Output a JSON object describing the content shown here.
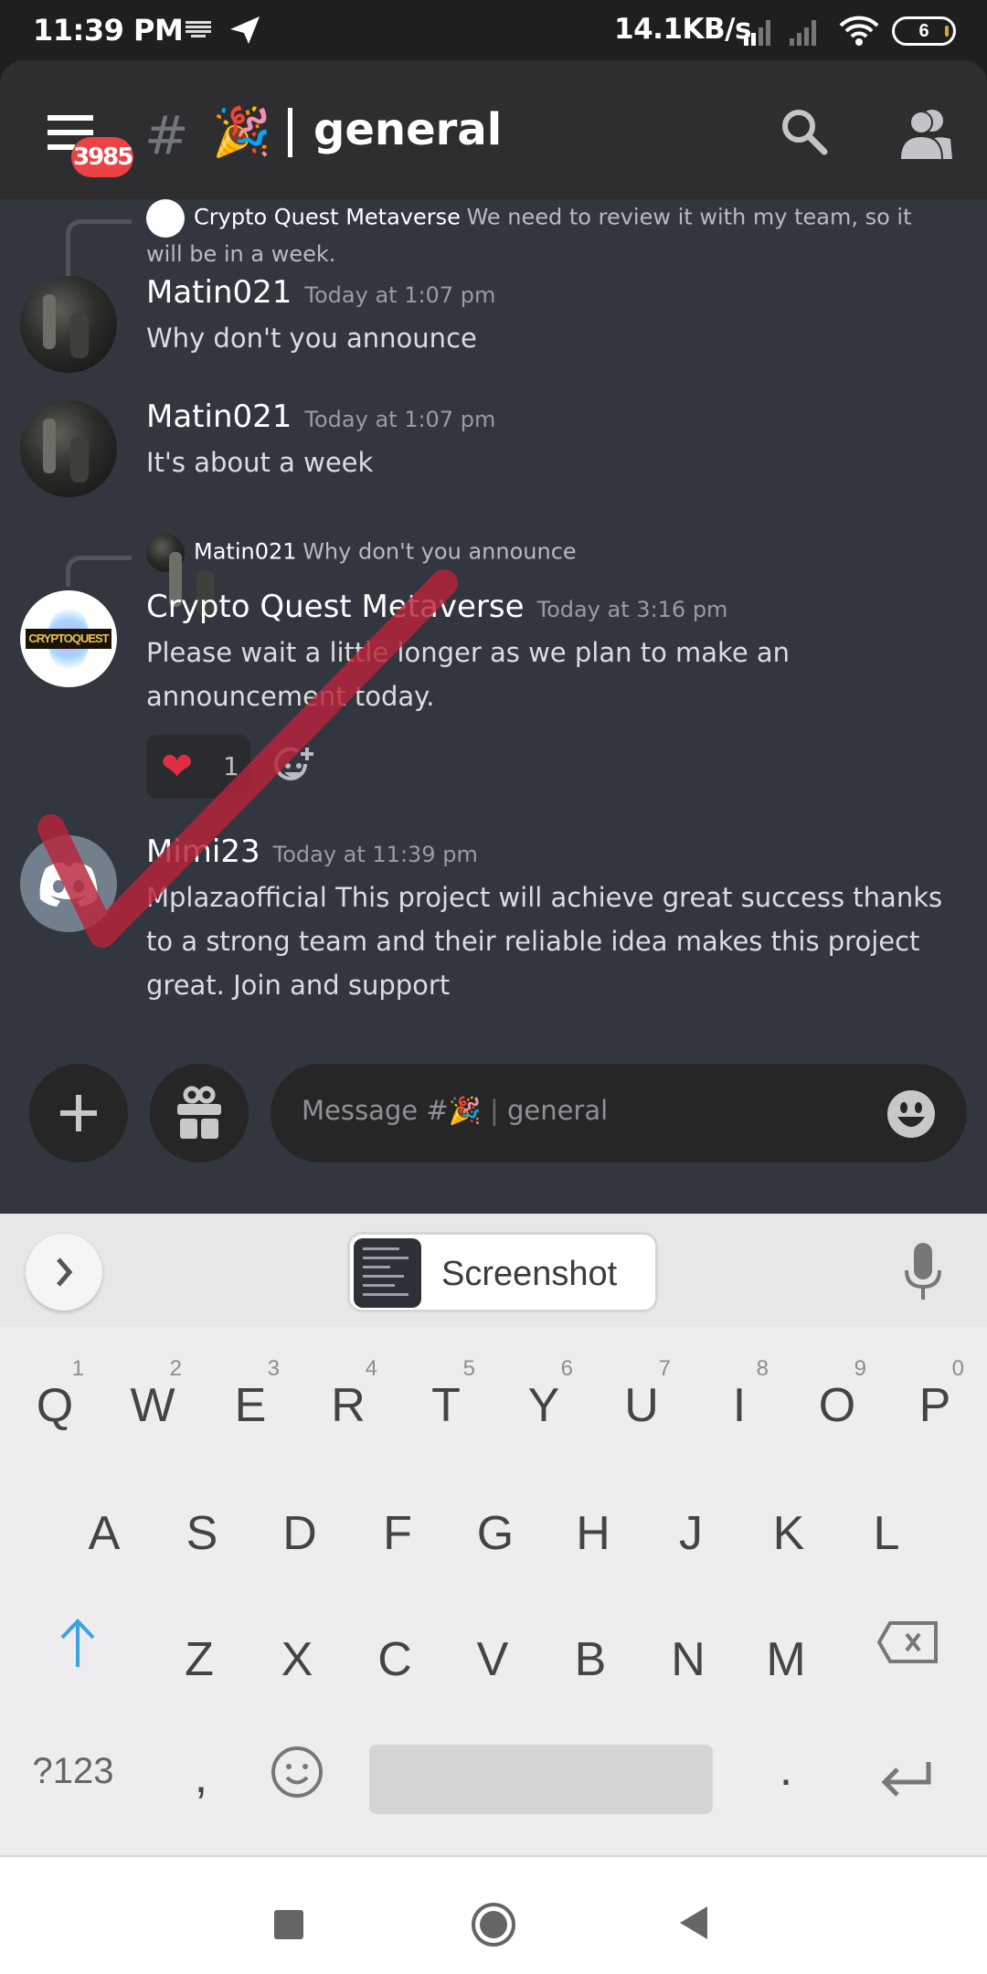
{
  "status_bar": {
    "time": "11:39 PM",
    "net_speed": "14.1KB/s",
    "battery": "6",
    "icons": [
      "keyboard-icon",
      "telegram-icon",
      "signal-icon",
      "signal-icon",
      "wifi-icon",
      "battery-icon"
    ]
  },
  "header": {
    "unread_badge": "3985",
    "channel_prefix": "#",
    "channel_emoji": "🎉",
    "channel_name": "general",
    "icons": [
      "menu-icon",
      "search-icon",
      "members-icon"
    ]
  },
  "messages": [
    {
      "reply_to": {
        "author": "Crypto Quest Metaverse",
        "text": "We need to review it with my team, so it will be in a week."
      },
      "author": "Matin021",
      "timestamp": "Today at 1:07 pm",
      "text": "Why don't you announce"
    },
    {
      "author": "Matin021",
      "timestamp": "Today at 1:07 pm",
      "text": "It's about a week"
    },
    {
      "reply_to": {
        "author": "Matin021",
        "text": "Why don't you announce"
      },
      "author": "Crypto Quest Metaverse",
      "timestamp": "Today at 3:16 pm",
      "text": "Please wait a little longer as we plan to make an announcement today.",
      "reactions": [
        {
          "emoji": "❤",
          "count": "1"
        }
      ],
      "avatar_text": "CRYPTOQUEST"
    },
    {
      "author": "Mimi23",
      "timestamp": "Today at 11:39 pm",
      "text": "Mplazaofficial This project will achieve great success thanks to a strong team and their reliable idea makes this project great. Join and support"
    }
  ],
  "composer": {
    "placeholder_prefix": "Message #",
    "placeholder_emoji": "🎉",
    "placeholder_channel": "general"
  },
  "keyboard": {
    "suggestion_chip": "Screenshot",
    "row1": [
      {
        "key": "Q",
        "num": "1"
      },
      {
        "key": "W",
        "num": "2"
      },
      {
        "key": "E",
        "num": "3"
      },
      {
        "key": "R",
        "num": "4"
      },
      {
        "key": "T",
        "num": "5"
      },
      {
        "key": "Y",
        "num": "6"
      },
      {
        "key": "U",
        "num": "7"
      },
      {
        "key": "I",
        "num": "8"
      },
      {
        "key": "O",
        "num": "9"
      },
      {
        "key": "P",
        "num": "0"
      }
    ],
    "row2": [
      "A",
      "S",
      "D",
      "F",
      "G",
      "H",
      "J",
      "K",
      "L"
    ],
    "row3": [
      "Z",
      "X",
      "C",
      "V",
      "B",
      "N",
      "M"
    ],
    "symbols_key": "?123",
    "comma_key": ",",
    "period_key": "."
  },
  "colors": {
    "accent_red": "#ed4245",
    "annotation_red": "#b8243a",
    "shift_blue": "#3aa3e0",
    "chat_bg": "#32363e"
  }
}
